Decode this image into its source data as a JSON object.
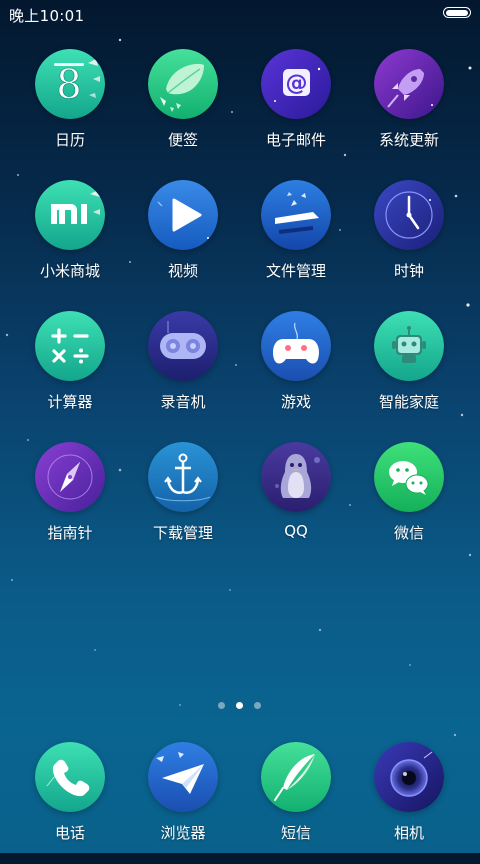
{
  "status_bar": {
    "time": "晚上10:01"
  },
  "apps": [
    {
      "label": "日历",
      "icon": "calendar-icon"
    },
    {
      "label": "便签",
      "icon": "notes-icon"
    },
    {
      "label": "电子邮件",
      "icon": "email-icon"
    },
    {
      "label": "系统更新",
      "icon": "rocket-icon"
    },
    {
      "label": "小米商城",
      "icon": "mi-store-icon"
    },
    {
      "label": "视频",
      "icon": "play-icon"
    },
    {
      "label": "文件管理",
      "icon": "file-manager-icon"
    },
    {
      "label": "时钟",
      "icon": "clock-icon"
    },
    {
      "label": "计算器",
      "icon": "calculator-icon"
    },
    {
      "label": "录音机",
      "icon": "recorder-icon"
    },
    {
      "label": "游戏",
      "icon": "gamepad-icon"
    },
    {
      "label": "智能家庭",
      "icon": "robot-icon"
    },
    {
      "label": "指南针",
      "icon": "compass-icon"
    },
    {
      "label": "下载管理",
      "icon": "anchor-icon"
    },
    {
      "label": "QQ",
      "icon": "penguin-icon"
    },
    {
      "label": "微信",
      "icon": "wechat-icon"
    }
  ],
  "page_indicator": {
    "count": 3,
    "active": 1
  },
  "dock": [
    {
      "label": "电话",
      "icon": "phone-icon"
    },
    {
      "label": "浏览器",
      "icon": "paper-plane-icon"
    },
    {
      "label": "短信",
      "icon": "feather-icon"
    },
    {
      "label": "相机",
      "icon": "camera-lens-icon"
    }
  ]
}
